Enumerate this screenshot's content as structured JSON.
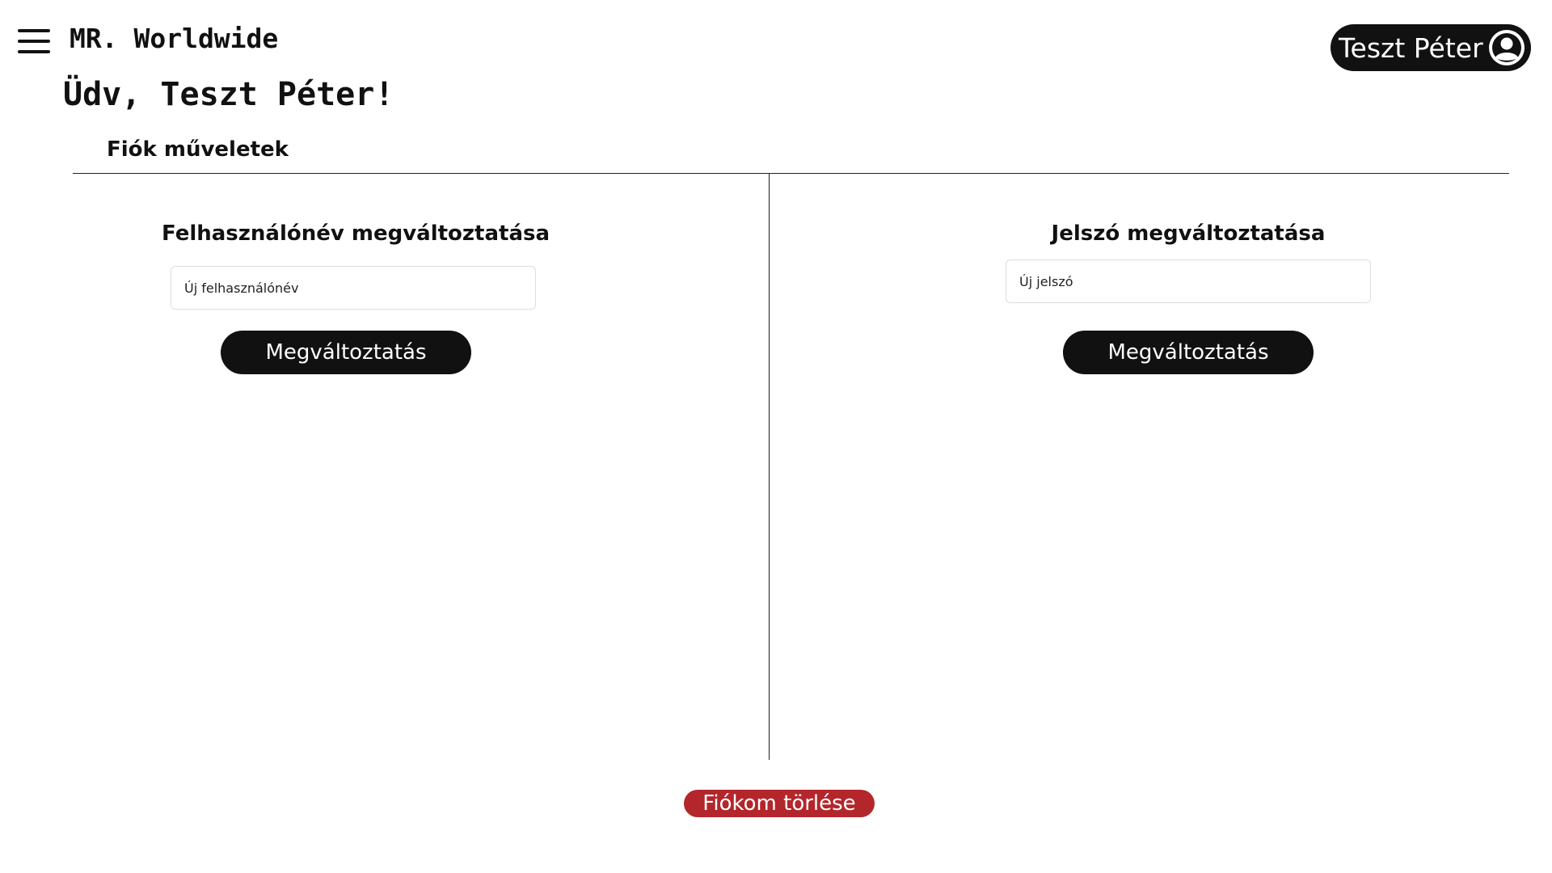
{
  "header": {
    "brand": "MR. Worldwide",
    "user_name": "Teszt Péter"
  },
  "main": {
    "greeting": "Üdv, Teszt Péter!",
    "section_title": "Fiók műveletek",
    "username_panel": {
      "title": "Felhasználónév megváltoztatása",
      "input_placeholder": "Új felhasználónév",
      "input_value": "",
      "button_label": "Megváltoztatás"
    },
    "password_panel": {
      "title": "Jelszó megváltoztatása",
      "input_placeholder": "Új jelszó",
      "input_value": "",
      "button_label": "Megváltoztatás"
    },
    "delete_label": "Fiókom törlése"
  },
  "icons": {
    "menu": "hamburger-menu-icon",
    "user": "user-circle-icon"
  },
  "colors": {
    "primary": "#111111",
    "danger": "#b3262b",
    "background": "#ffffff"
  }
}
